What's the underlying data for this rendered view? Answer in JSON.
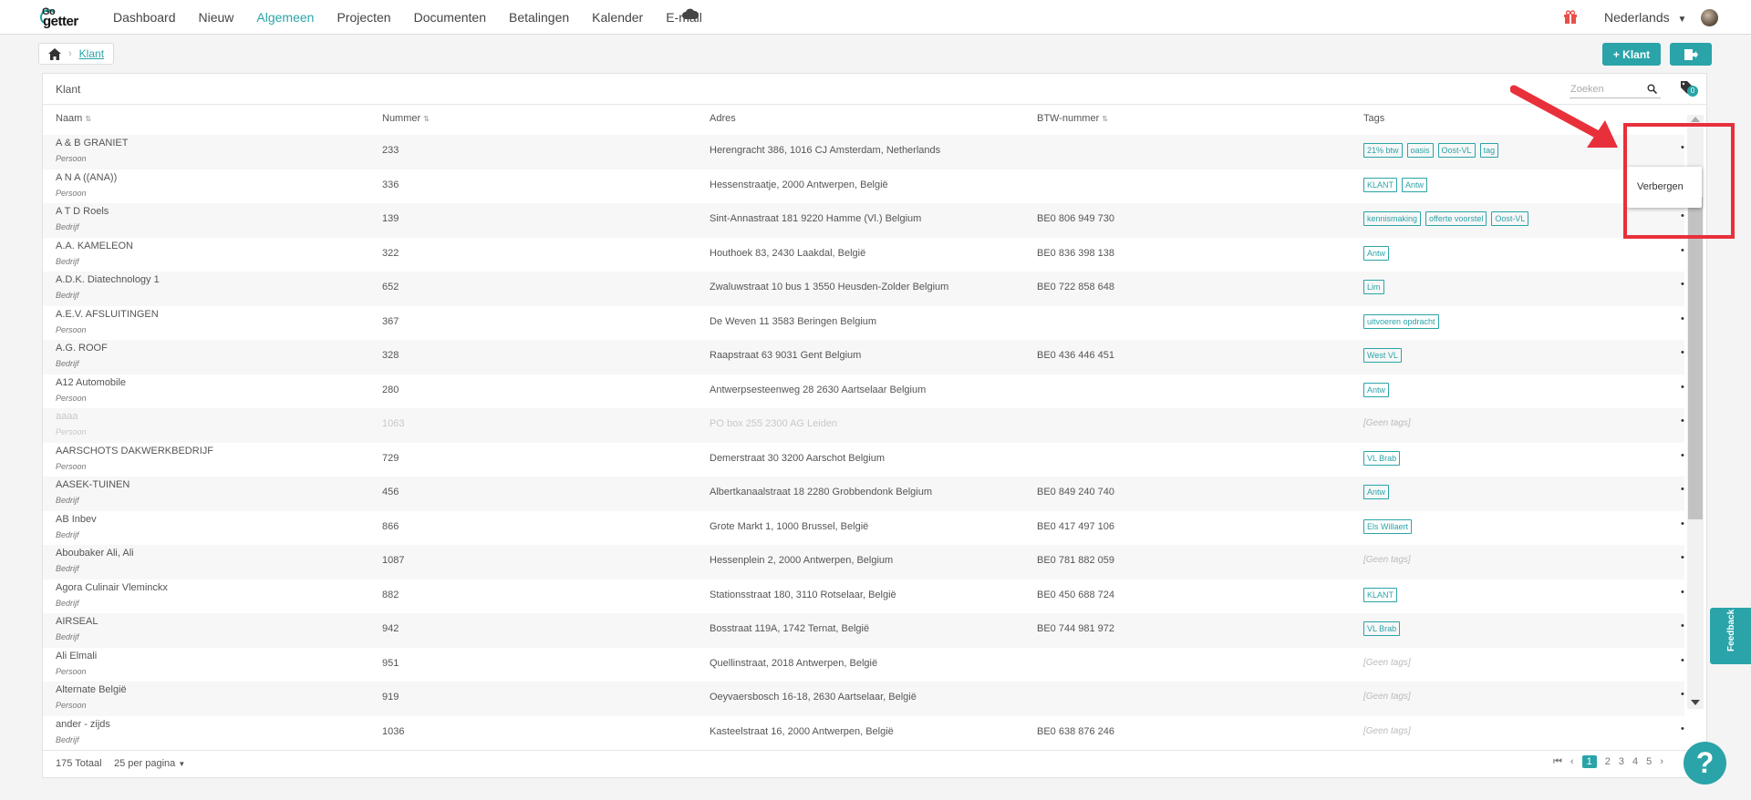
{
  "app": {
    "logo_top": "Go",
    "logo_bottom": "getter"
  },
  "nav": {
    "items": [
      "Dashboard",
      "Nieuw",
      "Algemeen",
      "Projecten",
      "Documenten",
      "Betalingen",
      "Kalender",
      "E-mail"
    ],
    "active": "Algemeen"
  },
  "header": {
    "language": "Nederlands"
  },
  "breadcrumb": {
    "current": "Klant"
  },
  "toolbar": {
    "add_label": "+ Klant"
  },
  "panel": {
    "title": "Klant",
    "search_placeholder": "Zoeken",
    "tag_count": "0"
  },
  "table": {
    "columns": [
      "Naam",
      "Nummer",
      "Adres",
      "BTW-nummer",
      "Tags"
    ],
    "rows": [
      {
        "name": "A & B GRANIET",
        "type": "Persoon",
        "number": "233",
        "address": "Herengracht 386, 1016 CJ Amsterdam, Netherlands",
        "btw": "",
        "tags": [
          "21% btw",
          "oasis",
          "Oost-VL",
          "tag"
        ]
      },
      {
        "name": "A N A ((ANA))",
        "type": "Persoon",
        "number": "336",
        "address": "Hessenstraatje, 2000 Antwerpen, België",
        "btw": "",
        "tags": [
          "KLANT",
          "Antw"
        ]
      },
      {
        "name": "A T D Roels",
        "type": "Bedrijf",
        "number": "139",
        "address": "Sint-Annastraat 181 9220 Hamme (Vl.) Belgium",
        "btw": "BE0 806 949 730",
        "tags": [
          "kennismaking",
          "offerte voorstel",
          "Oost-VL"
        ]
      },
      {
        "name": "A.A. KAMELEON",
        "type": "Bedrijf",
        "number": "322",
        "address": "Houthoek 83, 2430 Laakdal, België",
        "btw": "BE0 836 398 138",
        "tags": [
          "Antw"
        ]
      },
      {
        "name": "A.D.K. Diatechnology 1",
        "type": "Bedrijf",
        "number": "652",
        "address": "Zwaluwstraat 10 bus 1 3550 Heusden-Zolder Belgium",
        "btw": "BE0 722 858 648",
        "tags": [
          "Lim"
        ]
      },
      {
        "name": "A.E.V. AFSLUITINGEN",
        "type": "Persoon",
        "number": "367",
        "address": "De Weven 11 3583 Beringen Belgium",
        "btw": "",
        "tags": [
          "uitvoeren opdracht"
        ]
      },
      {
        "name": "A.G. ROOF",
        "type": "Bedrijf",
        "number": "328",
        "address": "Raapstraat 63 9031 Gent Belgium",
        "btw": "BE0 436 446 451",
        "tags": [
          "West VL"
        ]
      },
      {
        "name": "A12 Automobile",
        "type": "Persoon",
        "number": "280",
        "address": "Antwerpsesteenweg 28 2630 Aartselaar Belgium",
        "btw": "",
        "tags": [
          "Antw"
        ]
      },
      {
        "name": "aaaa",
        "type": "Persoon",
        "number": "1063",
        "address": "PO box 255 2300 AG Leiden",
        "btw": "",
        "tags": [],
        "dim": true
      },
      {
        "name": "AARSCHOTS DAKWERKBEDRIJF",
        "type": "Persoon",
        "number": "729",
        "address": "Demerstraat 30 3200 Aarschot Belgium",
        "btw": "",
        "tags": [
          "VL Brab"
        ]
      },
      {
        "name": "AASEK-TUINEN",
        "type": "Bedrijf",
        "number": "456",
        "address": "Albertkanaalstraat 18 2280 Grobbendonk Belgium",
        "btw": "BE0 849 240 740",
        "tags": [
          "Antw"
        ]
      },
      {
        "name": "AB Inbev",
        "type": "Bedrijf",
        "number": "866",
        "address": "Grote Markt 1, 1000 Brussel, België",
        "btw": "BE0 417 497 106",
        "tags": [
          "Els Willaert"
        ]
      },
      {
        "name": "Aboubaker Ali, Ali",
        "type": "Bedrijf",
        "number": "1087",
        "address": "Hessenplein 2, 2000 Antwerpen, Belgium",
        "btw": "BE0 781 882 059",
        "tags": []
      },
      {
        "name": "Agora Culinair Vleminckx",
        "type": "Bedrijf",
        "number": "882",
        "address": "Stationsstraat 180, 3110 Rotselaar, België",
        "btw": "BE0 450 688 724",
        "tags": [
          "KLANT"
        ]
      },
      {
        "name": "AIRSEAL",
        "type": "Bedrijf",
        "number": "942",
        "address": "Bosstraat 119A, 1742 Ternat, België",
        "btw": "BE0 744 981 972",
        "tags": [
          "VL Brab"
        ]
      },
      {
        "name": "Ali Elmali",
        "type": "Persoon",
        "number": "951",
        "address": "Quellinstraat, 2018 Antwerpen, België",
        "btw": "",
        "tags": []
      },
      {
        "name": "Alternate België",
        "type": "Persoon",
        "number": "919",
        "address": "Oeyvaersbosch 16-18, 2630 Aartselaar, België",
        "btw": "",
        "tags": []
      },
      {
        "name": "ander - zijds",
        "type": "Bedrijf",
        "number": "1036",
        "address": "Kasteelstraat 16, 2000 Antwerpen, België",
        "btw": "BE0 638 876 246",
        "tags": []
      }
    ],
    "no_tags_label": "[Geen tags]"
  },
  "footer": {
    "total": "175 Totaal",
    "per_page": "25 per pagina",
    "pages": [
      "1",
      "2",
      "3",
      "4",
      "5"
    ],
    "current_page": "1"
  },
  "menu": {
    "item": "Verbergen"
  },
  "feedback_label": "Feedback",
  "help_label": "?",
  "colors": {
    "accent": "#2aa4a8",
    "annotation": "#e8303b"
  }
}
